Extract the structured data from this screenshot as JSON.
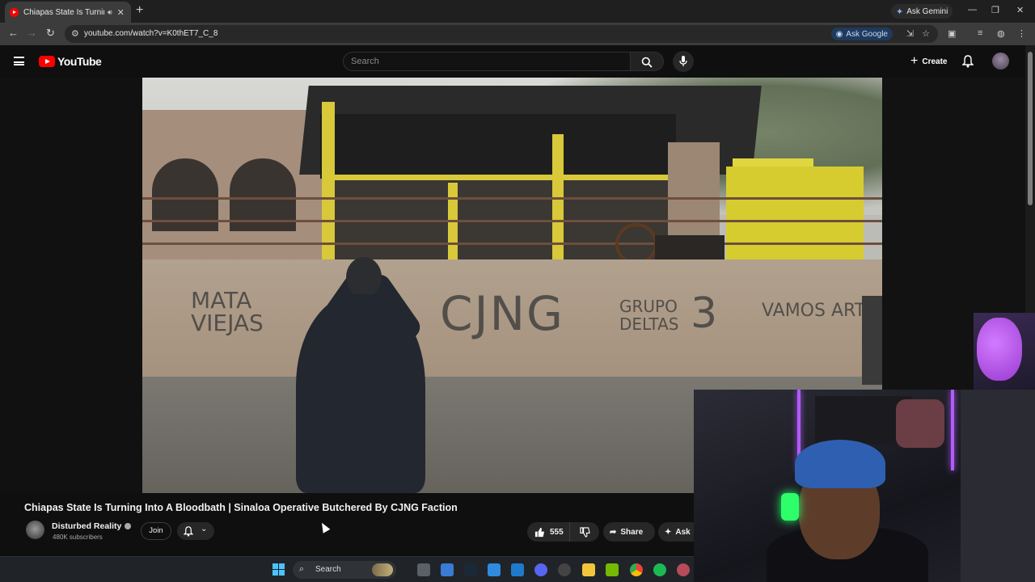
{
  "browser": {
    "tab_title": "Chiapas State Is Turning Int",
    "tab_audio_icon": "speaker-icon",
    "new_tab_icon": "plus-icon",
    "gemini_label": "Ask Gemini",
    "url": "youtube.com/watch?v=K0thET7_C_8",
    "ask_google_label": "Ask Google",
    "window_controls": [
      "minimize",
      "restore",
      "close"
    ]
  },
  "youtube": {
    "logo_text": "YouTube",
    "search_placeholder": "Search",
    "create_label": "Create"
  },
  "video": {
    "title": "Chiapas State Is Turning Into A Bloodbath | Sinaloa Operative Butchered By CJNG Faction",
    "channel_name": "Disturbed Reality",
    "subscribers": "480K subscribers",
    "join_label": "Join",
    "like_count": "555",
    "share_label": "Share",
    "ask_label": "Ask",
    "graffiti": {
      "left": "MATA\nVIEJAS",
      "center": "CJNG",
      "right1": "GRUPO\nDELTAS",
      "right2": "3",
      "far_right": "VAMOS ARTI"
    }
  },
  "taskbar": {
    "search_label": "Search",
    "apps": [
      "file-explorer-icon",
      "store-icon",
      "steam-icon",
      "notepad-icon",
      "photos-icon",
      "discord-icon",
      "settings-icon",
      "folder-icon",
      "nvidia-icon",
      "chrome-icon",
      "spotify-icon",
      "app-icon"
    ]
  },
  "colors": {
    "youtube_red": "#ff0000",
    "background": "#0f0f0f",
    "accent_blue": "#8ab4f8"
  }
}
